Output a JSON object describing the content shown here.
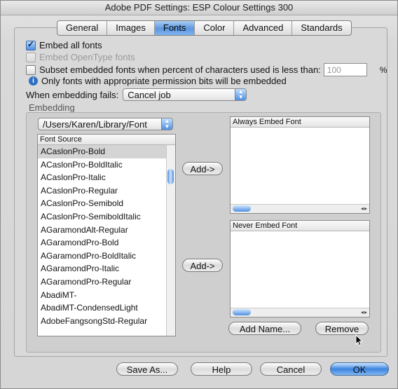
{
  "window": {
    "title": "Adobe PDF Settings: ESP Colour Settings 300"
  },
  "tabs": [
    {
      "label": "General"
    },
    {
      "label": "Images"
    },
    {
      "label": "Fonts"
    },
    {
      "label": "Color"
    },
    {
      "label": "Advanced"
    },
    {
      "label": "Standards"
    }
  ],
  "active_tab": "Fonts",
  "fonts": {
    "embed_all_label": "Embed all fonts",
    "embed_all_checked": true,
    "embed_opentype_label": "Embed OpenType fonts",
    "embed_opentype_enabled": false,
    "subset_label": "Subset embedded fonts when percent of characters used is less than:",
    "subset_checked": false,
    "subset_value": "100",
    "subset_unit": "%",
    "permission_note": "Only fonts with appropriate permission bits will be embedded",
    "fail_label": "When embedding fails:",
    "fail_value": "Cancel job",
    "embedding_group_label": "Embedding",
    "font_source_path": "/Users/Karen/Library/Font",
    "font_source_header": "Font Source",
    "font_source_items": [
      "ACaslonPro-Bold",
      "ACaslonPro-BoldItalic",
      "ACaslonPro-Italic",
      "ACaslonPro-Regular",
      "ACaslonPro-Semibold",
      "ACaslonPro-SemiboldItalic",
      "AGaramondAlt-Regular",
      "AGaramondPro-Bold",
      "AGaramondPro-BoldItalic",
      "AGaramondPro-Italic",
      "AGaramondPro-Regular",
      "AbadiMT-",
      "AbadiMT-CondensedLight",
      "AdobeFangsongStd-Regular"
    ],
    "selected_index": 0,
    "always_embed_header": "Always Embed Font",
    "never_embed_header": "Never Embed Font",
    "add_always_label": "Add->",
    "add_never_label": "Add->",
    "add_name_label": "Add Name...",
    "remove_label": "Remove"
  },
  "footer": {
    "save_as_label": "Save As...",
    "help_label": "Help",
    "cancel_label": "Cancel",
    "ok_label": "OK"
  },
  "colors": {
    "accent": "#4f8fe0",
    "window_bg": "#d7d7d7"
  }
}
